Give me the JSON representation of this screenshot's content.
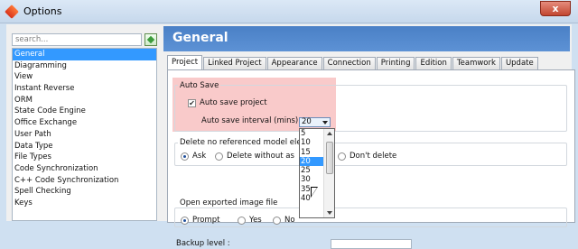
{
  "window": {
    "title": "Options",
    "close_label": "x"
  },
  "sidebar": {
    "search_placeholder": "search...",
    "items": [
      {
        "label": "General",
        "selected": true
      },
      {
        "label": "Diagramming"
      },
      {
        "label": "View"
      },
      {
        "label": "Instant Reverse"
      },
      {
        "label": "ORM"
      },
      {
        "label": "State Code Engine"
      },
      {
        "label": "Office Exchange"
      },
      {
        "label": "User Path"
      },
      {
        "label": "Data Type"
      },
      {
        "label": "File Types"
      },
      {
        "label": "Code Synchronization"
      },
      {
        "label": "C++ Code Synchronization"
      },
      {
        "label": "Spell Checking"
      },
      {
        "label": "Keys"
      }
    ]
  },
  "main": {
    "title": "General",
    "tabs": [
      {
        "label": "Project",
        "active": true
      },
      {
        "label": "Linked Project"
      },
      {
        "label": "Appearance"
      },
      {
        "label": "Connection"
      },
      {
        "label": "Printing"
      },
      {
        "label": "Edition"
      },
      {
        "label": "Teamwork"
      },
      {
        "label": "Update"
      }
    ],
    "auto_save": {
      "group_title": "Auto Save",
      "checkbox_label": "Auto save project",
      "checked": true,
      "interval_label": "Auto save interval (mins) :",
      "interval_value": "20",
      "interval_options": [
        "5",
        "10",
        "15",
        "20",
        "25",
        "30",
        "35",
        "40"
      ]
    },
    "delete_model": {
      "group_title": "Delete no referenced model elem",
      "options": [
        "Ask",
        "Delete without as",
        "Don't delete"
      ],
      "selected": "Ask"
    },
    "open_image": {
      "group_title": "Open exported image file",
      "options": [
        "Prompt",
        "Yes",
        "No"
      ],
      "selected": "Prompt"
    },
    "backup": {
      "label": "Backup level :"
    }
  },
  "colors": {
    "header": "#5085c9",
    "selection": "#3399ff",
    "highlight": "#f9caca"
  }
}
